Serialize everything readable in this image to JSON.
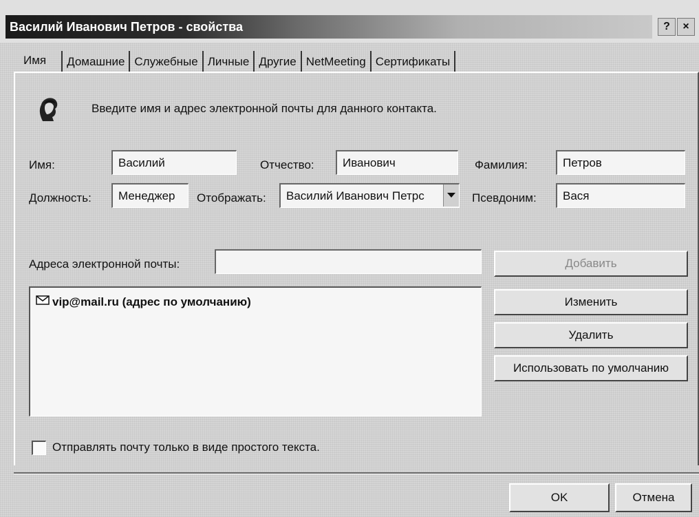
{
  "window": {
    "title": "Василий Иванович Петров - свойства",
    "help_button": "?",
    "close_button": "×"
  },
  "tabs": [
    {
      "label": "Имя",
      "active": true
    },
    {
      "label": "Домашние"
    },
    {
      "label": "Служебные"
    },
    {
      "label": "Личные"
    },
    {
      "label": "Другие"
    },
    {
      "label": "NetMeeting"
    },
    {
      "label": "Сертификаты"
    }
  ],
  "intro_text": "Введите имя и адрес электронной почты для данного контакта.",
  "form": {
    "first_name_label": "Имя:",
    "first_name_value": "Василий",
    "middle_name_label": "Отчество:",
    "middle_name_value": "Иванович",
    "last_name_label": "Фамилия:",
    "last_name_value": "Петров",
    "title_label": "Должность:",
    "title_value": "Менеджер",
    "display_label": "Отображать:",
    "display_value": "Василий Иванович Петрс",
    "nickname_label": "Псевдоним:",
    "nickname_value": "Вася"
  },
  "email": {
    "label": "Адреса электронной почты:",
    "input_value": "",
    "items": [
      {
        "text": "vip@mail.ru  (адрес по умолчанию)"
      }
    ]
  },
  "buttons": {
    "add": "Добавить",
    "edit": "Изменить",
    "remove": "Удалить",
    "set_default": "Использовать по умолчанию",
    "ok": "OK",
    "cancel": "Отмена"
  },
  "plain_text": {
    "label": "Отправлять почту только в виде простого текста.",
    "checked": false
  }
}
